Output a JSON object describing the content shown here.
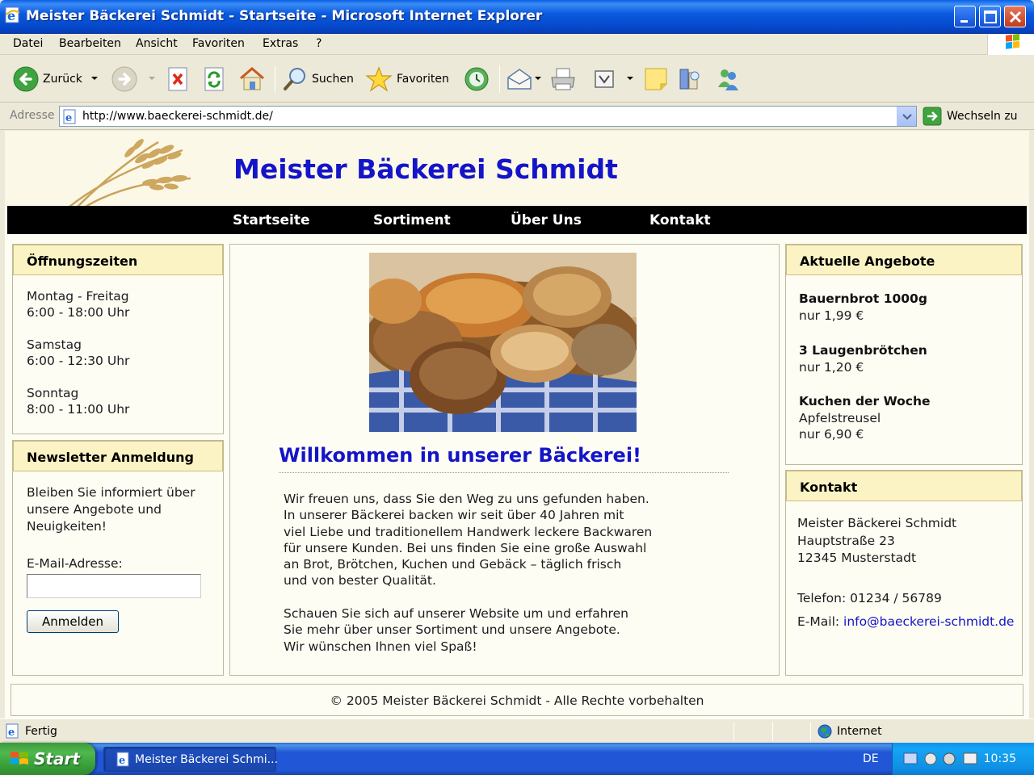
{
  "window": {
    "title": "Meister Bäckerei Schmidt - Startseite - Microsoft Internet Explorer"
  },
  "menu": [
    "Datei",
    "Bearbeiten",
    "Ansicht",
    "Favoriten",
    "Extras",
    "?"
  ],
  "toolbar": {
    "back_label": "Zurück",
    "search_label": "Suchen",
    "favorites_label": "Favoriten"
  },
  "address": {
    "label": "Adresse",
    "url": "http://www.baeckerei-schmidt.de/",
    "go_label": "Wechseln zu"
  },
  "site": {
    "title": "Meister Bäckerei Schmidt",
    "nav": [
      "Startseite",
      "Sortiment",
      "Über Uns",
      "Kontakt"
    ]
  },
  "hours": {
    "heading": "Öffnungszeiten",
    "entries": [
      {
        "day": "Montag - Freitag",
        "time": "6:00 - 18:00 Uhr"
      },
      {
        "day": "Samstag",
        "time": "6:00 - 12:30 Uhr"
      },
      {
        "day": "Sonntag",
        "time": "8:00 - 11:00 Uhr"
      }
    ]
  },
  "newsletter": {
    "heading": "Newsletter Anmeldung",
    "text": [
      "Bleiben Sie informiert über",
      "unsere Angebote und",
      "Neuigkeiten!"
    ],
    "email_label": "E-Mail-Adresse:",
    "email_value": "",
    "submit_label": "Anmelden"
  },
  "main": {
    "welcome": "Willkommen in unserer Bäckerei!",
    "paragraph1": [
      "Wir freuen uns, dass Sie den Weg zu uns gefunden haben.",
      "In unserer Bäckerei backen wir seit über 40 Jahren mit",
      "viel Liebe und traditionellem Handwerk leckere Backwaren",
      "für unsere Kunden. Bei uns finden Sie eine große Auswahl",
      "an Brot, Brötchen, Kuchen und Gebäck – täglich frisch",
      "und von bester Qualität."
    ],
    "paragraph2": [
      "Schauen Sie sich auf unserer Website um und erfahren",
      "Sie mehr über unser Sortiment und unsere Angebote.",
      "Wir wünschen Ihnen viel Spaß!"
    ]
  },
  "offers": {
    "heading": "Aktuelle Angebote",
    "items": [
      {
        "name": "Bauernbrot 1000g",
        "detail": "",
        "price": "nur 1,99 €"
      },
      {
        "name": "3 Laugenbrötchen",
        "detail": "",
        "price": "nur 1,20 €"
      },
      {
        "name": "Kuchen der Woche",
        "detail": "Apfelstreusel",
        "price": "nur 6,90 €"
      }
    ]
  },
  "contact": {
    "heading": "Kontakt",
    "name": "Meister Bäckerei Schmidt",
    "street": "Hauptstraße 23",
    "city": "12345 Musterstadt",
    "phone": "Telefon: 01234 / 56789",
    "email_prefix": "E-Mail:",
    "email": "info@baeckerei-schmidt.de"
  },
  "footer": {
    "text": "© 2005 Meister Bäckerei Schmidt - Alle Rechte vorbehalten"
  },
  "status": {
    "text": "Fertig",
    "zone": "Internet"
  },
  "taskbar": {
    "start_label": "Start",
    "task_label": "Meister Bäckerei Schmi...",
    "language": "DE",
    "clock": "10:35"
  },
  "colors": {
    "site_title": "#1414c8",
    "box_header": "#fcf3c4",
    "nav_bg": "#000000",
    "link": "#1414c8"
  }
}
